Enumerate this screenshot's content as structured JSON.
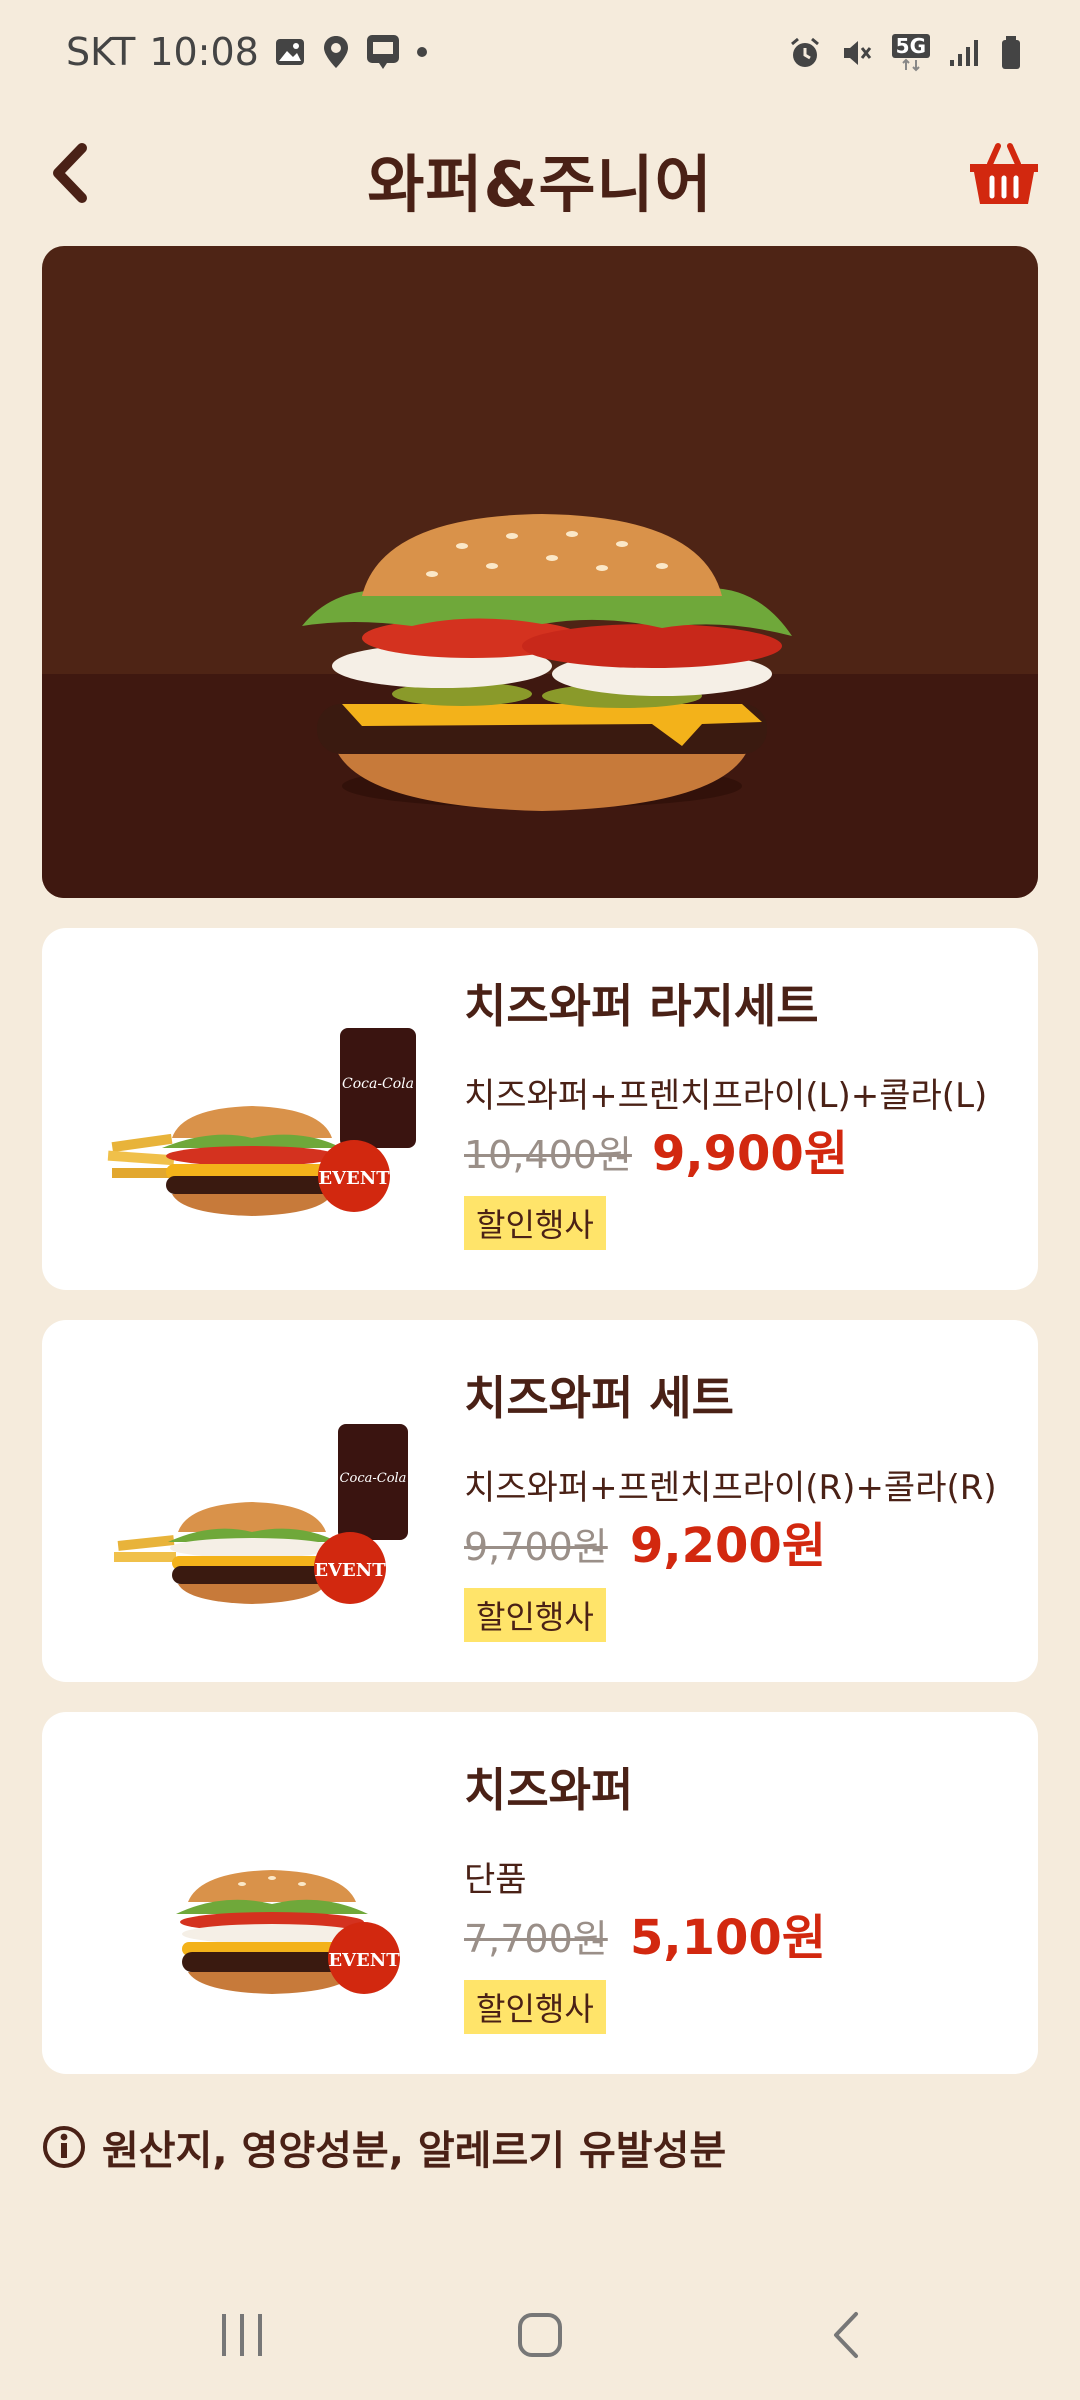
{
  "status_bar": {
    "carrier": "SKT",
    "time": "10:08",
    "network": "5G"
  },
  "header": {
    "title": "와퍼&주니어"
  },
  "colors": {
    "background": "#f5ebdc",
    "brown": "#4a2116",
    "red": "#d2280f",
    "badge_yellow": "#ffe46a"
  },
  "products": [
    {
      "name": "치즈와퍼 라지세트",
      "desc": "치즈와퍼+프렌치프라이(L)+콜라(L)",
      "old_price": "10,400원",
      "price": "9,900원",
      "badge": "할인행사",
      "event_label": "EVENT",
      "cup_label": "Coca-Cola"
    },
    {
      "name": "치즈와퍼 세트",
      "desc": "치즈와퍼+프렌치프라이(R)+콜라(R)",
      "old_price": "9,700원",
      "price": "9,200원",
      "badge": "할인행사",
      "event_label": "EVENT",
      "cup_label": "Coca-Cola"
    },
    {
      "name": "치즈와퍼",
      "desc": "단품",
      "old_price": "7,700원",
      "price": "5,100원",
      "badge": "할인행사",
      "event_label": "EVENT"
    }
  ],
  "footer": {
    "info_link": "원산지, 영양성분, 알레르기 유발성분"
  }
}
